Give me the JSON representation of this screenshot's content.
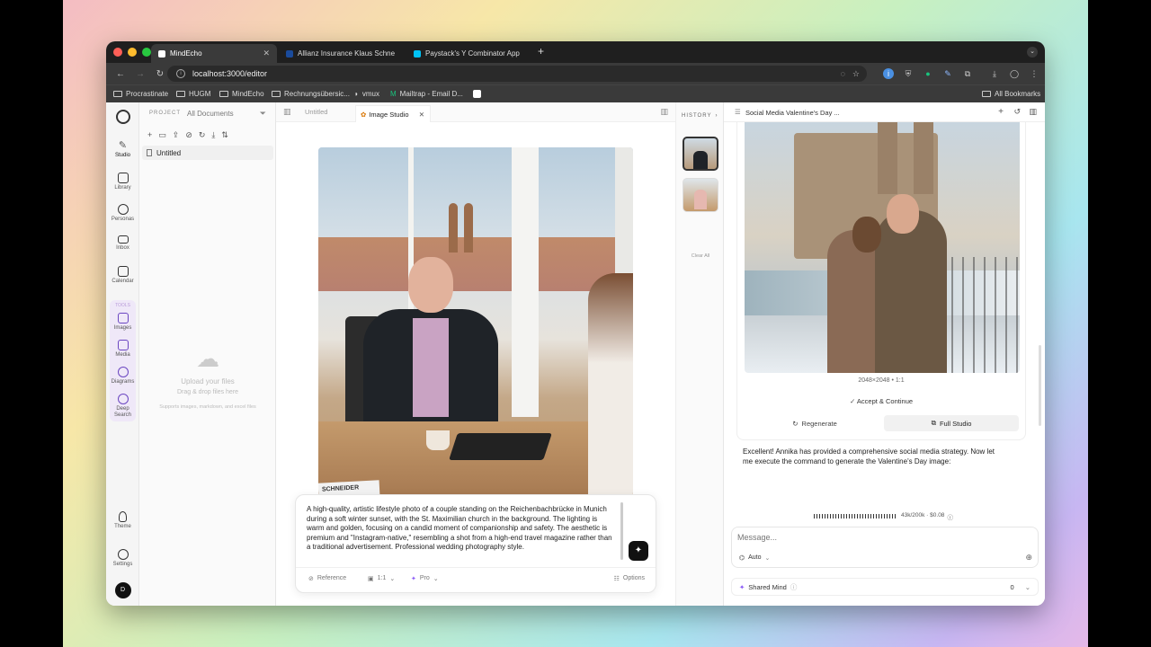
{
  "browser": {
    "tabs": [
      {
        "label": "MindEcho"
      },
      {
        "label": "Allianz Insurance Klaus Schne"
      },
      {
        "label": "Paystack's Y Combinator App"
      }
    ],
    "url": "localhost:3000/editor",
    "bookmarks": [
      "Procrastinate",
      "HUGM",
      "MindEcho",
      "Rechnungsübersic...",
      "vmux",
      "Mailtrap - Email D...",
      "All Bookmarks"
    ]
  },
  "rail": {
    "items": [
      "Studio",
      "Library",
      "Personas",
      "Inbox",
      "Calendar"
    ],
    "tools_label": "TOOLS",
    "tools": [
      "Images",
      "Media",
      "Diagrams",
      "Deep Search"
    ],
    "bottom": [
      "Theme",
      "Settings"
    ],
    "avatar": "D"
  },
  "files": {
    "project_label": "PROJECT",
    "project_value": "All Documents",
    "file": "Untitled",
    "upload_title": "Upload your files",
    "upload_sub": "Drag & drop files here",
    "upload_note": "Supports images, markdown, and excel files"
  },
  "editor": {
    "tabs": [
      "Untitled",
      "Image Studio"
    ],
    "nameplate": "SCHNEIDER",
    "prompt": "A high-quality, artistic lifestyle photo of a couple standing on the Reichenbachbrücke in Munich during a soft winter sunset, with the St. Maximilian church in the background. The lighting is warm and golden, focusing on a candid moment of companionship and safety. The aesthetic is premium and \"Instagram-native,\" resembling a shot from a high-end travel magazine rather than a traditional advertisement. Professional wedding photography style.",
    "reference": "Reference",
    "ratio": "1:1",
    "quality": "Pro",
    "options": "Options"
  },
  "history": {
    "label": "HISTORY",
    "clear": "Clear All"
  },
  "chat": {
    "title": "Social Media Valentine's Day ...",
    "meta": "2048×2048 • 1:1",
    "accept": "Accept & Continue",
    "regenerate": "Regenerate",
    "full_studio": "Full Studio",
    "message": "Excellent! Annika has provided a comprehensive social media strategy. Now let me execute the command to generate the Valentine's Day image:",
    "tokens": "43k/200k · $0.08",
    "input_placeholder": "Message...",
    "model": "Auto",
    "shared_mind": "Shared Mind",
    "shared_count": "0"
  },
  "colors": {
    "accent": "#8b5cf6",
    "red": "#ff5f57",
    "yellow": "#febc2e",
    "green": "#28c840"
  }
}
